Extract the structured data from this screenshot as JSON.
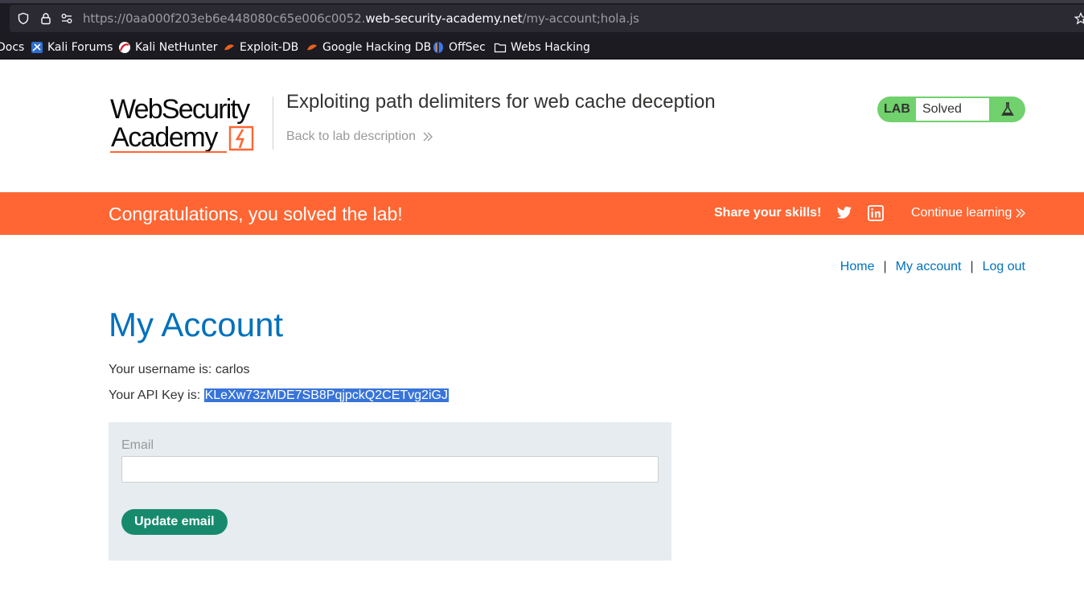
{
  "browser": {
    "url_prefix": "https://0aa000f203eb6e448080c65e006c0052.",
    "url_host": "web-security-academy.net",
    "url_path": "/my-account;hola.js",
    "bookmarks": [
      {
        "label": "Docs",
        "icon": "docs-icon"
      },
      {
        "label": "Kali Forums",
        "icon": "kali-forums-icon"
      },
      {
        "label": "Kali NetHunter",
        "icon": "kali-nethunter-icon"
      },
      {
        "label": "Exploit-DB",
        "icon": "exploit-db-icon"
      },
      {
        "label": "Google Hacking DB",
        "icon": "ghdb-icon"
      },
      {
        "label": "OffSec",
        "icon": "offsec-icon"
      },
      {
        "label": "Webs Hacking",
        "icon": "folder-icon"
      }
    ]
  },
  "header": {
    "logo_line1": "WebSecurity",
    "logo_line2": "Academy",
    "lab_title": "Exploiting path delimiters for web cache deception",
    "back_link": "Back to lab description",
    "badge_label": "LAB",
    "badge_status": "Solved",
    "status_color": "#70d16d"
  },
  "banner": {
    "congrats": "Congratulations, you solved the lab!",
    "share": "Share your skills!",
    "continue": "Continue learning",
    "color": "#ff6633"
  },
  "nav": {
    "home": "Home",
    "sep1": "|",
    "my_account": "My account",
    "sep2": "|",
    "log_out": "Log out"
  },
  "account": {
    "title": "My Account",
    "username_prefix": "Your username is: ",
    "username": "carlos",
    "apikey_prefix": "Your API Key is: ",
    "apikey": "KLeXw73zMDE7SB8PqjpckQ2CETvg2iGJ"
  },
  "form": {
    "email_label": "Email",
    "email_value": "",
    "update_button": "Update email"
  }
}
